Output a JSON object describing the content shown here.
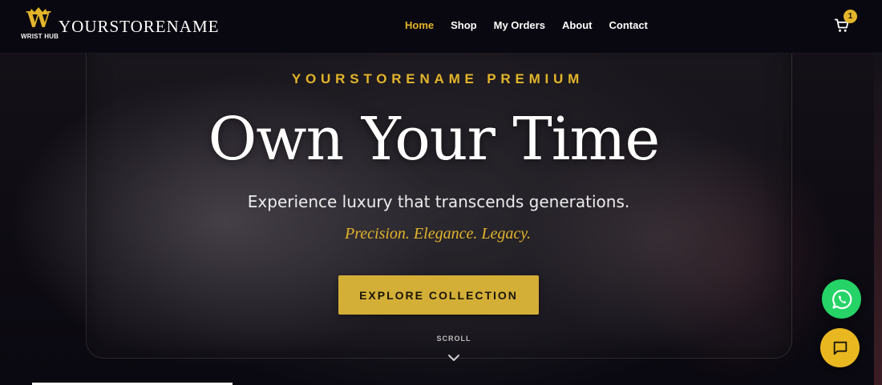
{
  "header": {
    "logo_letter": "W",
    "logo_caption": "WRIST HUB",
    "store_name": "YOURSTORENAME",
    "nav": [
      {
        "label": "Home",
        "active": true
      },
      {
        "label": "Shop",
        "active": false
      },
      {
        "label": "My Orders",
        "active": false
      },
      {
        "label": "About",
        "active": false
      },
      {
        "label": "Contact",
        "active": false
      }
    ],
    "cart_icon": "cart-icon",
    "cart_count": "1"
  },
  "hero": {
    "eyebrow": "YOURSTORENAME PREMIUM",
    "title": "Own Your Time",
    "subtitle": "Experience luxury that transcends generations.",
    "tagline": "Precision. Elegance. Legacy.",
    "cta_label": "EXPLORE COLLECTION",
    "scroll_label": "SCROLL",
    "scroll_icon": "chevron-down-icon"
  },
  "floating": {
    "whatsapp_icon": "whatsapp-icon",
    "chat_icon": "chat-icon"
  },
  "colors": {
    "accent_gold": "#e3b52a",
    "button_gold": "#d4af37",
    "whatsapp_green": "#25d366",
    "header_bg": "#09070f"
  }
}
